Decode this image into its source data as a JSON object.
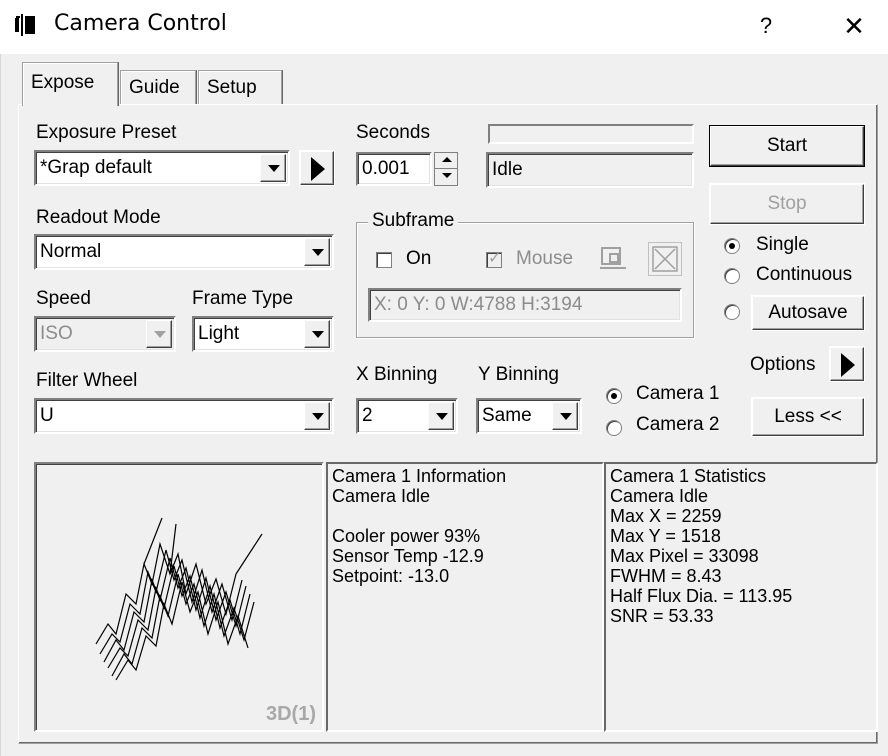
{
  "window": {
    "title": "Camera Control",
    "help": "?",
    "close": "✕"
  },
  "tabs": [
    "Expose",
    "Guide",
    "Setup"
  ],
  "exposure_preset": {
    "label": "Exposure Preset",
    "value": "*Grap default"
  },
  "seconds": {
    "label": "Seconds",
    "value": "0.001"
  },
  "status": {
    "value": "Idle",
    "progress": 0
  },
  "buttons": {
    "start": "Start",
    "stop": "Stop",
    "autosave": "Autosave",
    "options": "Options",
    "less": "Less <<"
  },
  "capture_mode": {
    "single": "Single",
    "continuous": "Continuous",
    "selected": "Single"
  },
  "readout_mode": {
    "label": "Readout Mode",
    "value": "Normal"
  },
  "subframe": {
    "label": "Subframe",
    "on": "On",
    "on_checked": false,
    "mouse": "Mouse",
    "mouse_checked": true,
    "coords": "X:   0 Y:   0 W:4788 H:3194"
  },
  "speed": {
    "label": "Speed",
    "value": "ISO"
  },
  "frame_type": {
    "label": "Frame Type",
    "value": "Light"
  },
  "filter_wheel": {
    "label": "Filter Wheel",
    "value": "U"
  },
  "x_binning": {
    "label": "X Binning",
    "value": "2"
  },
  "y_binning": {
    "label": "Y Binning",
    "value": "Same"
  },
  "camera_select": {
    "camera1": "Camera 1",
    "camera2": "Camera 2",
    "selected": "Camera 1"
  },
  "plot": {
    "label": "3D(1)"
  },
  "info": {
    "title": "Camera 1 Information",
    "lines": [
      "Camera Idle",
      "",
      "Cooler power 93%",
      "Sensor Temp -12.9",
      "Setpoint: -13.0"
    ]
  },
  "stats": {
    "title": "Camera 1 Statistics",
    "lines": [
      "Camera Idle",
      "Max X = 2259",
      "Max Y = 1518",
      "Max Pixel = 33098",
      "FWHM = 8.43",
      "Half Flux Dia. = 113.95",
      "SNR = 53.33"
    ]
  }
}
